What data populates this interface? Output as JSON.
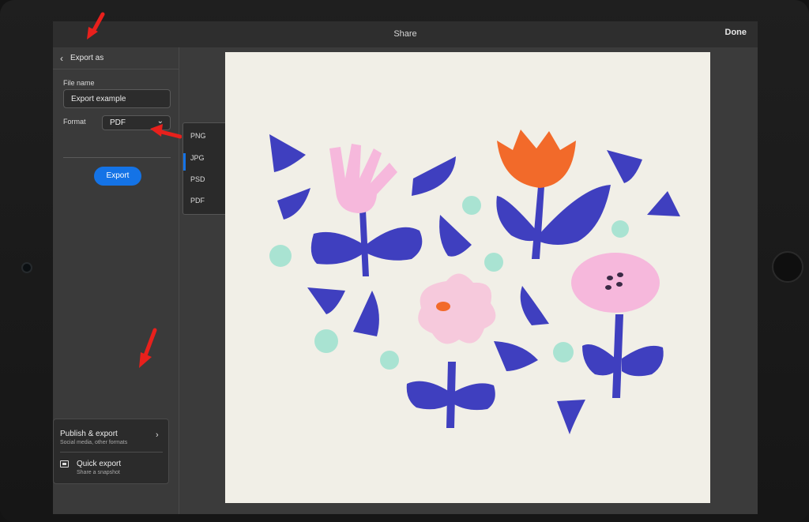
{
  "header": {
    "title": "Share",
    "done_label": "Done"
  },
  "panel": {
    "back_label": "Export as",
    "file_name_label": "File name",
    "file_name_value": "Export example",
    "format_label": "Format",
    "format_value": "PDF",
    "export_button": "Export"
  },
  "format_menu": {
    "options": [
      "PNG",
      "JPG",
      "PSD",
      "PDF"
    ]
  },
  "share_popover": {
    "publish_title": "Publish & export",
    "publish_subtitle": "Social media, other formats",
    "quick_title": "Quick export",
    "quick_subtitle": "Share a snapshot"
  },
  "colors": {
    "accent": "#1473e6",
    "annotation_arrow": "#e8201c",
    "flower_blue": "#3f3fbf",
    "flower_pink": "#f6b8dc",
    "flower_orange": "#f26a2a",
    "dot_mint": "#a9e3d2",
    "canvas_bg": "#f1efe7"
  }
}
